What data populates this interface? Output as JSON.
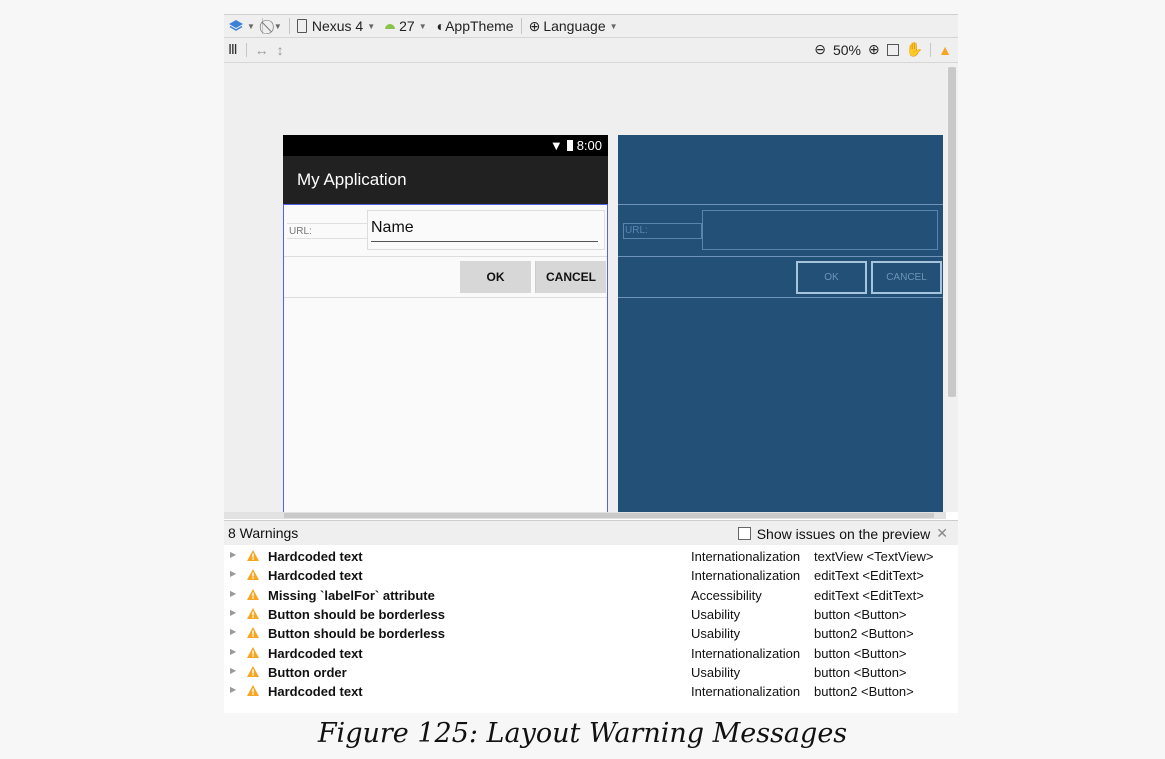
{
  "toolbar": {
    "device": "Nexus 4",
    "api": "27",
    "theme": "AppTheme",
    "language": "Language",
    "zoom": "50%"
  },
  "phone": {
    "time": "8:00",
    "app_title": "My Application",
    "url_label": "URL:",
    "name_value": "Name",
    "ok_label": "OK",
    "cancel_label": "CANCEL"
  },
  "blueprint": {
    "url_label": "URL:",
    "ok_label": "OK",
    "cancel_label": "CANCEL"
  },
  "panel": {
    "title": "8 Warnings",
    "show_issues_label": "Show issues on the preview",
    "warnings": [
      {
        "message": "Hardcoded text",
        "category": "Internationalization",
        "location": "textView <TextView>"
      },
      {
        "message": "Hardcoded text",
        "category": "Internationalization",
        "location": "editText <EditText>"
      },
      {
        "message": "Missing `labelFor` attribute",
        "category": "Accessibility",
        "location": "editText <EditText>"
      },
      {
        "message": "Button should be borderless",
        "category": "Usability",
        "location": "button <Button>"
      },
      {
        "message": "Button should be borderless",
        "category": "Usability",
        "location": "button2 <Button>"
      },
      {
        "message": "Hardcoded text",
        "category": "Internationalization",
        "location": "button <Button>"
      },
      {
        "message": "Button order",
        "category": "Usability",
        "location": "button <Button>"
      },
      {
        "message": "Hardcoded text",
        "category": "Internationalization",
        "location": "button2 <Button>"
      }
    ]
  },
  "caption": "Figure 125: Layout Warning Messages",
  "colors": {
    "blueprint_bg": "#225077",
    "warning": "#f5a623",
    "selection": "#5561e3"
  }
}
